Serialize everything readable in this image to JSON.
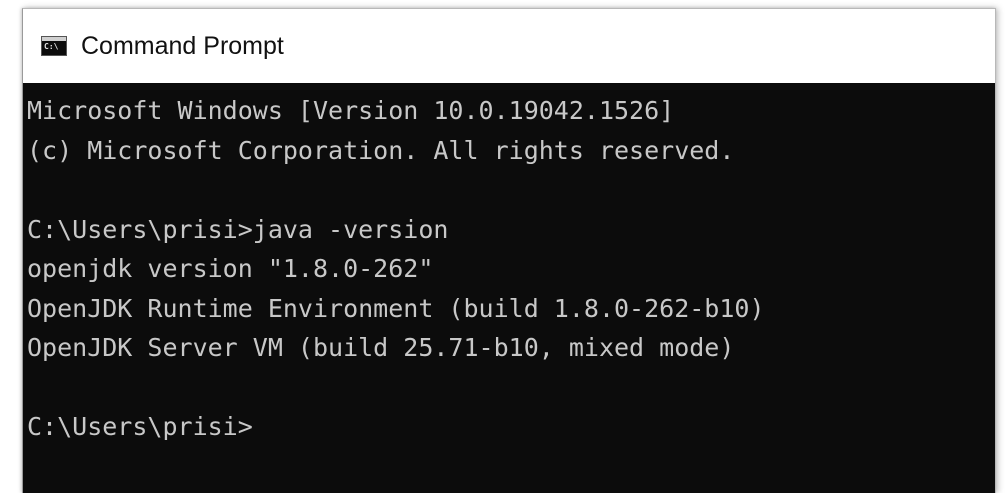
{
  "window": {
    "title": "Command Prompt",
    "icon": "cmd-icon",
    "icon_glyph": "C:\\"
  },
  "console": {
    "lines": [
      "Microsoft Windows [Version 10.0.19042.1526]",
      "(c) Microsoft Corporation. All rights reserved.",
      "",
      "C:\\Users\\prisi>java -version",
      "openjdk version \"1.8.0-262\"",
      "OpenJDK Runtime Environment (build 1.8.0-262-b10)",
      "OpenJDK Server VM (build 25.71-b10, mixed mode)",
      "",
      "C:\\Users\\prisi>"
    ]
  },
  "colors": {
    "console_background": "#0c0c0c",
    "console_text": "#c8c8c8",
    "titlebar_background": "#ffffff",
    "title_text": "#111111"
  }
}
